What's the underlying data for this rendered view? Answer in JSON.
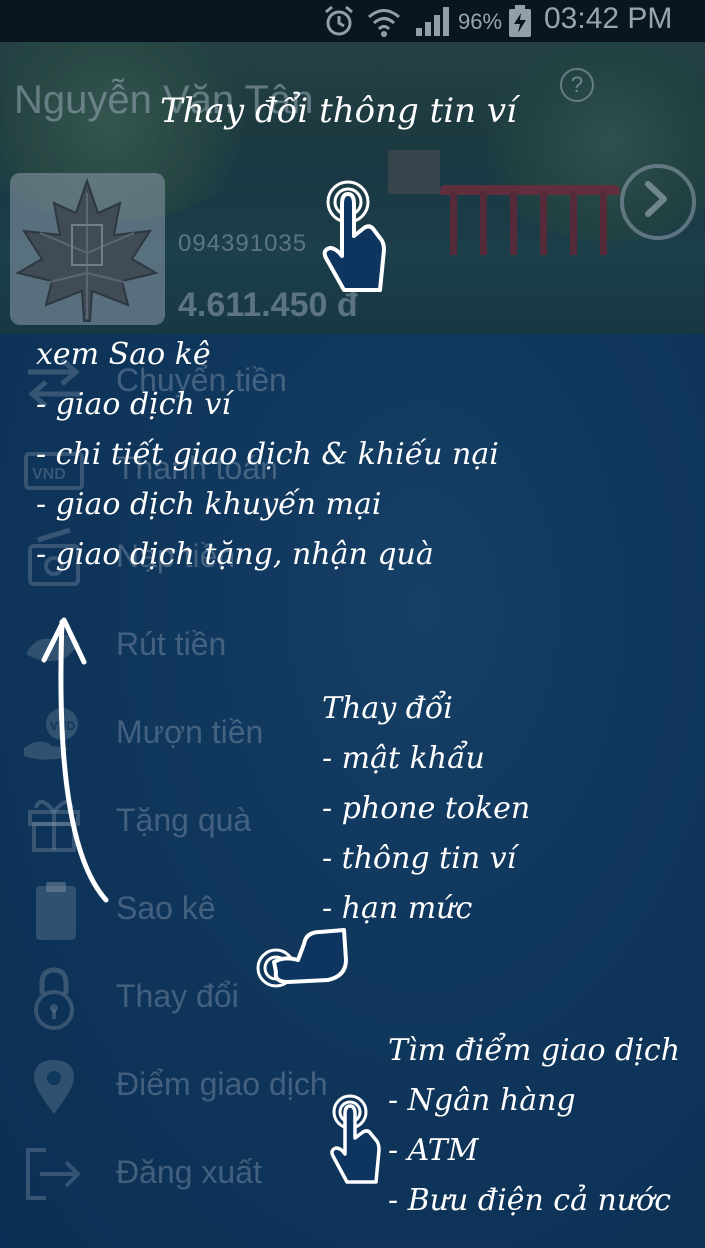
{
  "status_bar": {
    "battery_percent": "96%",
    "time": "03:42 PM",
    "icons": [
      "alarm-icon",
      "wifi-icon",
      "signal-icon",
      "battery-charging-icon"
    ]
  },
  "header": {
    "user_name": "Nguyễn Văn Tân",
    "phone": "094391035",
    "balance": "4.611.450 đ"
  },
  "menu": {
    "items": [
      {
        "label": "Chuyển tiền",
        "icon": "transfer-icon"
      },
      {
        "label": "Thanh toán",
        "icon": "payment-icon"
      },
      {
        "label": "Nạp tiền",
        "icon": "topup-icon"
      },
      {
        "label": "Rút tiền",
        "icon": "withdraw-icon"
      },
      {
        "label": "Mượn tiền",
        "icon": "borrow-icon"
      },
      {
        "label": "Tặng quà",
        "icon": "gift-icon"
      },
      {
        "label": "Sao kê",
        "icon": "clipboard-icon"
      },
      {
        "label": "Thay đổi",
        "icon": "lock-icon"
      },
      {
        "label": "Điểm giao dịch",
        "icon": "location-icon"
      },
      {
        "label": "Đăng xuất",
        "icon": "logout-icon"
      }
    ]
  },
  "tutorial": {
    "top_hint": "Thay đổi thông tin ví",
    "statement_hint": [
      "xem Sao kê",
      "- giao dịch ví",
      "- chi tiết giao dịch & khiếu nại",
      "- giao dịch khuyến mại",
      "- giao dịch tặng, nhận quà"
    ],
    "change_hint": [
      "Thay đổi",
      "- mật khẩu",
      "- phone token",
      "- thông tin ví",
      "- hạn mức"
    ],
    "location_hint": [
      "Tìm điểm giao dịch",
      "- Ngân hàng",
      "- ATM",
      "- Bưu điện cả nước"
    ]
  },
  "colors": {
    "status_bar_bg": "#0a0f16",
    "menu_bg": "#0c335a",
    "bridge_red": "#a8373c",
    "hint_text": "#ffffff"
  }
}
